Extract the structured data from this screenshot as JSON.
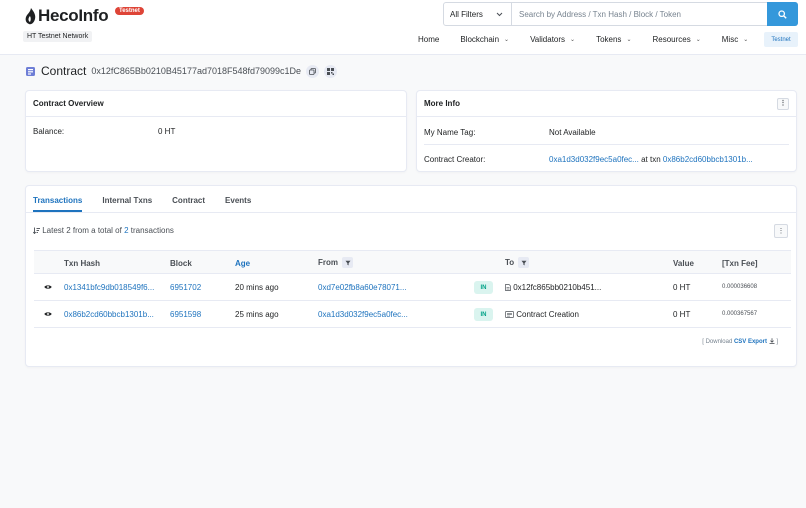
{
  "header": {
    "logo_text": "HecoInfo",
    "badge": "Testnet",
    "network": "HT Testnet Network",
    "search": {
      "filter_label": "All Filters",
      "placeholder": "Search by Address / Txn Hash / Block / Token"
    },
    "nav": [
      "Home",
      "Blockchain",
      "Validators",
      "Tokens",
      "Resources",
      "Misc"
    ],
    "nav_button": "Testnet"
  },
  "title": {
    "label": "Contract",
    "address": "0x12fC865Bb0210B45177ad7018F548fd79099c1De"
  },
  "overview": {
    "heading": "Contract Overview",
    "balance_label": "Balance:",
    "balance_value": "0 HT"
  },
  "more_info": {
    "heading": "More Info",
    "name_tag_label": "My Name Tag:",
    "name_tag_value": "Not Available",
    "creator_label": "Contract Creator:",
    "creator_address": "0xa1d3d032f9ec5a0fec...",
    "at_txn": "at txn",
    "creator_txn": "0x86b2cd60bbcb1301b..."
  },
  "tabs": [
    "Transactions",
    "Internal Txns",
    "Contract",
    "Events"
  ],
  "summary": {
    "prefix": "Latest 2 from a total of",
    "count": "2",
    "suffix": "transactions"
  },
  "table": {
    "headers": {
      "hash": "Txn Hash",
      "block": "Block",
      "age": "Age",
      "from": "From",
      "to": "To",
      "value": "Value",
      "fee": "[Txn Fee]"
    },
    "rows": [
      {
        "hash": "0x1341bfc9db018549f6...",
        "block": "6951702",
        "age": "20 mins ago",
        "from": "0xd7e02fb8a60e78071...",
        "direction": "IN",
        "to": "0x12fc865bb0210b451...",
        "to_icon": "file-icon",
        "value": "0 HT",
        "fee": "0.000036608"
      },
      {
        "hash": "0x86b2cd60bbcb1301b...",
        "block": "6951598",
        "age": "25 mins ago",
        "from": "0xa1d3d032f9ec5a0fec...",
        "direction": "IN",
        "to": "Contract Creation",
        "to_icon": "contract-creation-icon",
        "value": "0 HT",
        "fee": "0.000367567"
      }
    ]
  },
  "csv": {
    "prefix": "[ Download",
    "link": "CSV Export",
    "suffix": "]"
  },
  "colors": {
    "accent": "#3498db",
    "link": "#1e73be",
    "badge_red": "#de4437",
    "in_badge_bg": "#daf4ef",
    "in_badge_text": "#00a186"
  }
}
